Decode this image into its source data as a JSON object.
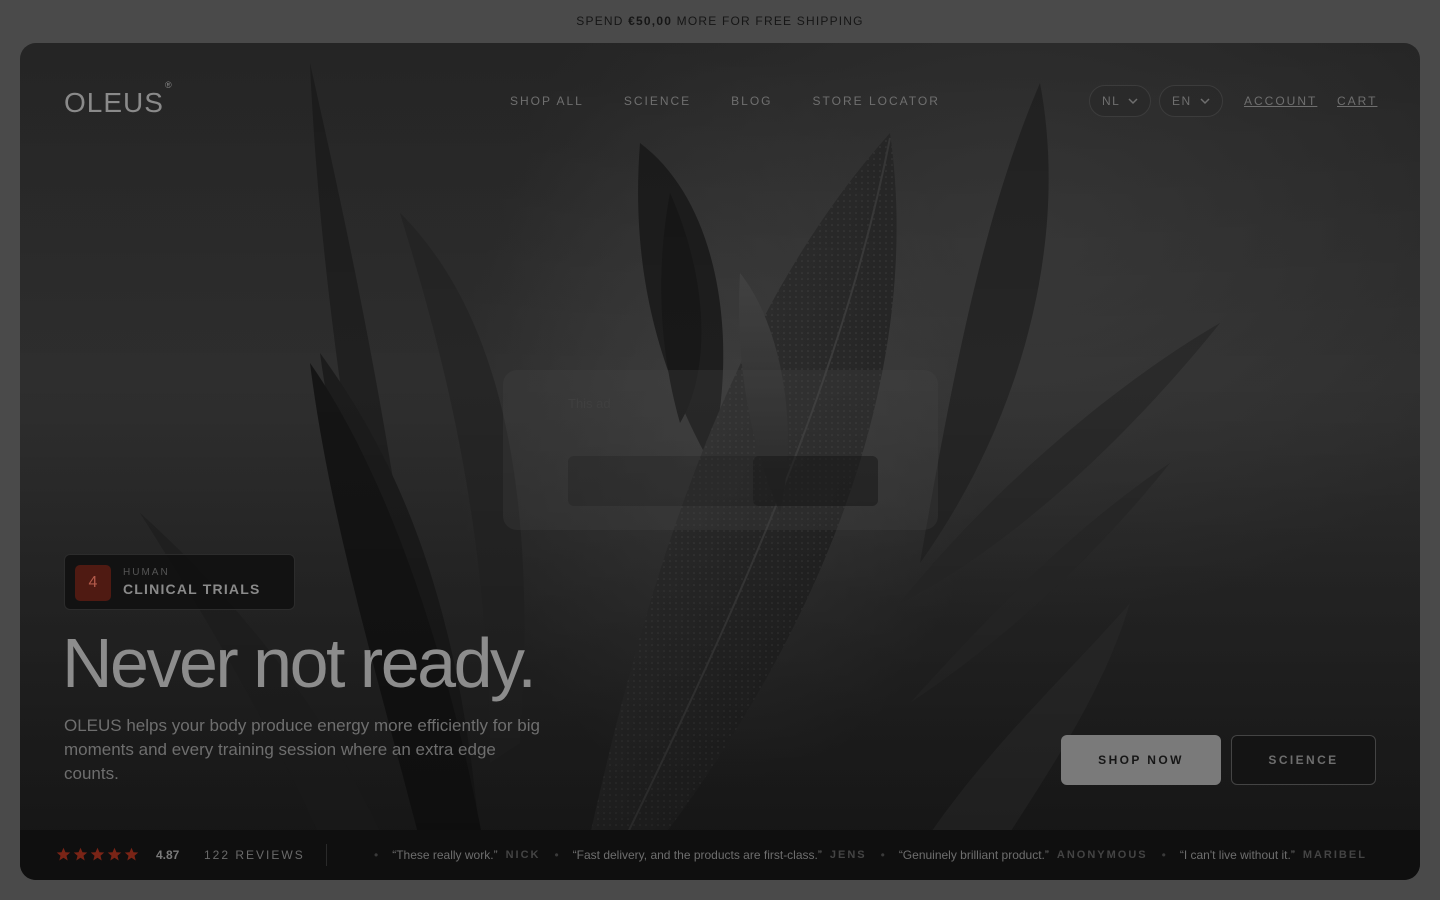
{
  "announcement": {
    "prefix": "SPEND",
    "amount": "€50,00",
    "suffix": "MORE FOR FREE SHIPPING"
  },
  "brand": {
    "name": "OLEUS",
    "mark": "®"
  },
  "nav": {
    "items": [
      "SHOP ALL",
      "SCIENCE",
      "BLOG",
      "STORE LOCATOR"
    ]
  },
  "selectors": {
    "country": "NL",
    "language": "EN"
  },
  "utility": {
    "account": "ACCOUNT",
    "cart": "CART"
  },
  "popup": {
    "text": "This ad"
  },
  "badge": {
    "number": "4",
    "top": "HUMAN",
    "main": "CLINICAL TRIALS"
  },
  "hero": {
    "headline": "Never not ready.",
    "subcopy": "OLEUS helps your body produce energy more efficiently for big moments and every training session where an extra edge counts."
  },
  "cta": {
    "shop": "SHOP NOW",
    "science": "SCIENCE"
  },
  "reviews": {
    "rating": 4.87,
    "rating_text": "4.87",
    "stars": 5,
    "count": "122 REVIEWS",
    "star_color": "#7a2416",
    "items": [
      {
        "quote": "“These really work.”",
        "author": "NICK"
      },
      {
        "quote": "“Fast delivery, and the products are first-class.”",
        "author": "JENS"
      },
      {
        "quote": "“Genuinely brilliant product.”",
        "author": "ANONYMOUS"
      },
      {
        "quote": "“I can't live without it.”",
        "author": "MARIBEL"
      }
    ]
  },
  "colors": {
    "accent": "#4f1a12",
    "background": "#4a4a4a",
    "hero_bg": "#2b2b2b"
  }
}
